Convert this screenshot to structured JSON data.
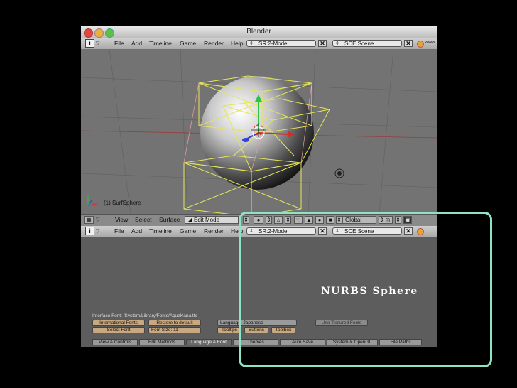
{
  "window": {
    "title": "Blender"
  },
  "menus": [
    "File",
    "Add",
    "Timeline",
    "Game",
    "Render",
    "Help"
  ],
  "top_header": {
    "screen": "SR:2-Model",
    "scene": "SCE:Scene",
    "www": "www"
  },
  "viewport": {
    "object_info": "(1) SurfSphere"
  },
  "edit_toolbar": {
    "view": "View",
    "select": "Select",
    "surface": "Surface",
    "mode": "Edit Mode",
    "orientation": "Global"
  },
  "bottom_header": {
    "screen": "SR:2-Model",
    "scene": "SCE:Scene"
  },
  "prefs": {
    "interface_font": "Interface Font: /System/Library/Fonts/AquaKana.ttc",
    "international_fonts": "International Fonts",
    "restore_default": "Restore to default",
    "select_font": "Select Font",
    "font_size": "Font Size:",
    "font_size_value": "11",
    "language": "Language:",
    "language_value": "Japanese",
    "tooltips": "Tooltips",
    "buttons": "Buttons",
    "toolbox": "Toolbox",
    "use_textured_fonts": "Use Textured Fonts",
    "tabs": [
      "View & Controls",
      "Edit Methods",
      "Language & Font",
      "Themes",
      "Auto Save",
      "System & OpenGL",
      "File Paths"
    ],
    "active_tab": "Language & Font"
  },
  "callout": {
    "text": "NURBS Sphere",
    "color": "#8fe3c5"
  }
}
